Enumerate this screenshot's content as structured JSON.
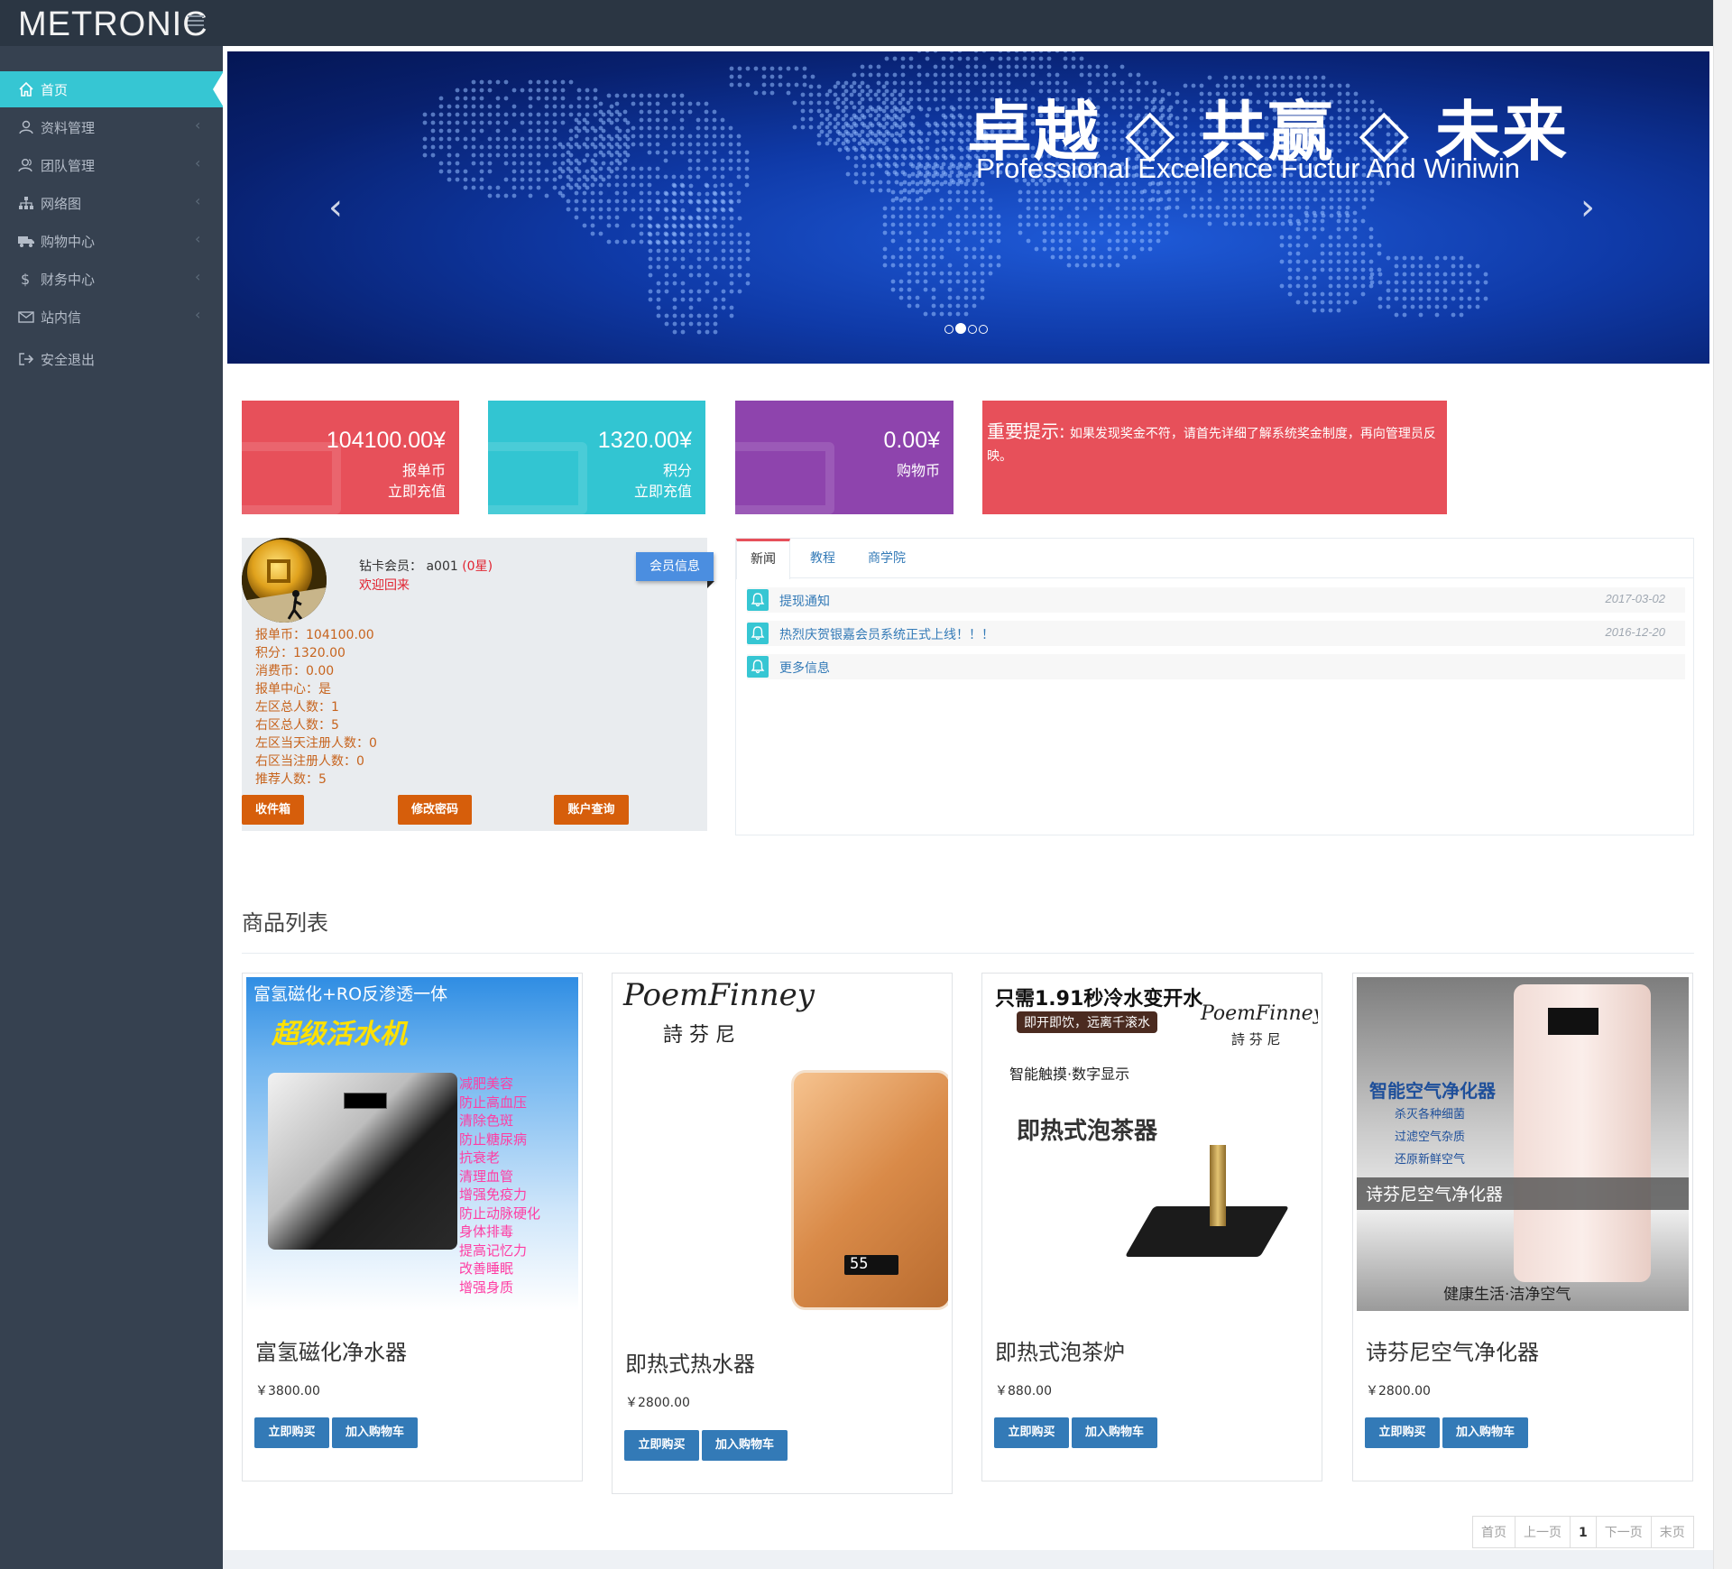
{
  "app": {
    "logo": "METRONIC"
  },
  "sidebar": {
    "items": [
      {
        "label": "首页",
        "icon": "home-icon",
        "active": true
      },
      {
        "label": "资料管理",
        "icon": "user-icon"
      },
      {
        "label": "团队管理",
        "icon": "users-icon"
      },
      {
        "label": "网络图",
        "icon": "sitemap-icon"
      },
      {
        "label": "购物中心",
        "icon": "truck-icon"
      },
      {
        "label": "财务中心",
        "icon": "dollar-icon"
      },
      {
        "label": "站内信",
        "icon": "envelope-icon"
      },
      {
        "label": "安全退出",
        "icon": "logout-icon"
      }
    ],
    "chevron": "‹"
  },
  "carousel": {
    "title": "卓越 ◇ 共赢 ◇ 未来",
    "subtitle": "Professional Excellence Fuctur And Winiwin",
    "prev": "‹",
    "next": "›",
    "slide_count": 4,
    "active_index": 1
  },
  "stats": [
    {
      "value": "104100.00¥",
      "label": "报单币",
      "action": "立即充值",
      "color": "#e7505a"
    },
    {
      "value": "1320.00¥",
      "label": "积分",
      "action": "立即充值",
      "color": "#32c5d2"
    },
    {
      "value": "0.00¥",
      "label": "购物币",
      "action": "",
      "color": "#8e44ad"
    }
  ],
  "notice": {
    "title": "重要提示:",
    "body": "如果发现奖金不符，请首先详细了解系统奖金制度，再向管理员反映。"
  },
  "member": {
    "level_prefix": "钻卡会员：",
    "username": "a001",
    "stars": "(0星)",
    "welcome": "欢迎回来",
    "badge": "会员信息",
    "stats": [
      "报单币：104100.00",
      "积分：1320.00",
      "消费币：0.00",
      "报单中心：是",
      "左区总人数：1",
      "右区总人数：5",
      "左区当天注册人数：0",
      "右区当注册人数：0",
      "推荐人数：5"
    ],
    "buttons": [
      "收件箱",
      "修改密码",
      "账户查询"
    ]
  },
  "news": {
    "tabs": [
      "新闻",
      "教程",
      "商学院"
    ],
    "items": [
      {
        "title": "提现通知",
        "date": "2017-03-02"
      },
      {
        "title": "热烈庆贺银嘉会员系统正式上线！！！",
        "date": "2016-12-20"
      },
      {
        "title": "更多信息",
        "date": ""
      }
    ]
  },
  "products": {
    "heading": "商品列表",
    "buy_label": "立即购买",
    "cart_label": "加入购物车",
    "items": [
      {
        "name": "富氢磁化净水器",
        "price": "￥3800.00",
        "img_top": "富氢磁化+RO反渗透一体",
        "img_big": "超级活水机",
        "img_lines": [
          "减肥美容",
          "防止高血压",
          "清除色斑",
          "防止糖尿病",
          "抗衰老",
          "清理血管",
          "增强免疫力",
          "防止动脉硬化",
          "身体排毒",
          "提高记忆力",
          "改善睡眠",
          "增强身质"
        ]
      },
      {
        "name": "即热式热水器",
        "price": "￥2800.00",
        "img_brand": "PoemFinney",
        "img_brand_cn": "詩 芬 尼",
        "img_display": "55"
      },
      {
        "name": "即热式泡茶炉",
        "price": "￥880.00",
        "img_top": "只需1.91秒冷水变开水",
        "img_sub": "即开即饮，远离千滚水",
        "img_brand": "PoemFinney",
        "img_brand_cn": "詩 芬 尼",
        "img_feature": "智能触摸·数字显示",
        "img_big": "即热式泡茶器"
      },
      {
        "name": "诗芬尼空气净化器",
        "price": "￥2800.00",
        "img_big": "智能空气净化器",
        "img_lines": [
          "杀灭各种细菌",
          "过滤空气杂质",
          "还原新鲜空气"
        ],
        "img_band": "诗芬尼空气净化器",
        "img_footer": "健康生活·洁净空气"
      }
    ]
  },
  "pagination": [
    "首页",
    "上一页",
    "1",
    "下一页",
    "末页"
  ]
}
